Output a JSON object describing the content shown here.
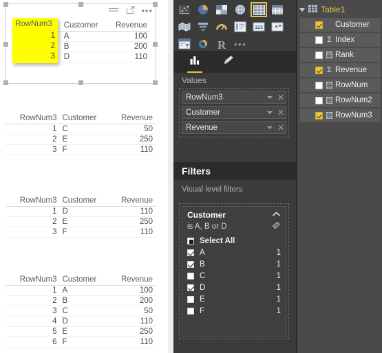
{
  "canvas": {
    "visuals": [
      {
        "id": "visual-filtered-top",
        "selected": true,
        "header": {
          "filter_icon": "filter-icon",
          "focus_icon": "focus-mode-icon",
          "more_icon": "more-options-ellipsis-icon"
        },
        "columns": [
          "RowNum3",
          "Customer",
          "Revenue"
        ],
        "rows": [
          [
            "1",
            "A",
            "100"
          ],
          [
            "2",
            "B",
            "200"
          ],
          [
            "3",
            "D",
            "110"
          ]
        ],
        "highlight": {
          "color": "#ffff00",
          "header": "RowNum3",
          "values": [
            "1",
            "2",
            "3"
          ]
        }
      },
      {
        "id": "visual-second",
        "selected": false,
        "columns": [
          "RowNum3",
          "Customer",
          "Revenue"
        ],
        "rows": [
          [
            "1",
            "C",
            "50"
          ],
          [
            "2",
            "E",
            "250"
          ],
          [
            "3",
            "F",
            "110"
          ]
        ]
      },
      {
        "id": "visual-third",
        "selected": false,
        "columns": [
          "RowNum3",
          "Customer",
          "Revenue"
        ],
        "rows": [
          [
            "1",
            "D",
            "110"
          ],
          [
            "2",
            "E",
            "250"
          ],
          [
            "3",
            "F",
            "110"
          ]
        ]
      },
      {
        "id": "visual-fourth",
        "selected": false,
        "columns": [
          "RowNum3",
          "Customer",
          "Revenue"
        ],
        "rows": [
          [
            "1",
            "A",
            "100"
          ],
          [
            "2",
            "B",
            "200"
          ],
          [
            "3",
            "C",
            "50"
          ],
          [
            "4",
            "D",
            "110"
          ],
          [
            "5",
            "E",
            "250"
          ],
          [
            "6",
            "F",
            "110"
          ]
        ]
      }
    ]
  },
  "visualizations": {
    "icon_rows": [
      [
        "scatter-chart-icon",
        "pie-chart-icon",
        "treemap-icon",
        "map-icon",
        "table-icon",
        "matrix-icon"
      ],
      [
        "filled-map-icon",
        "funnel-icon",
        "gauge-icon",
        "multi-row-card-icon",
        "card-icon",
        "kpi-icon"
      ],
      [
        "slicer-icon",
        "donut-chart-icon",
        "r-script-visual-icon",
        "more-visuals-ellipsis-icon"
      ]
    ],
    "selected_icon": "table-icon",
    "tabs": [
      {
        "name": "fields-tab",
        "icon": "bar-chart-icon",
        "active": true
      },
      {
        "name": "format-tab",
        "icon": "paintbrush-icon",
        "active": false
      }
    ],
    "values_header": "Values",
    "wells": [
      {
        "label": "RowNum3",
        "caret": "chevron-down-icon",
        "remove": "remove-field-icon"
      },
      {
        "label": "Customer",
        "caret": "chevron-down-icon",
        "remove": "remove-field-icon"
      },
      {
        "label": "Revenue",
        "caret": "chevron-down-icon",
        "remove": "remove-field-icon"
      }
    ],
    "filters_header": "Filters",
    "visual_level_filters_label": "Visual level filters",
    "filter_card": {
      "title": "Customer",
      "collapse_icon": "chevron-up-icon",
      "condition": "is A, B or D",
      "clear_icon": "eraser-clear-filter-icon",
      "items": [
        {
          "label": "Select All",
          "state": "indeterminate",
          "count": ""
        },
        {
          "label": "A",
          "state": "checked",
          "count": "1"
        },
        {
          "label": "B",
          "state": "checked",
          "count": "1"
        },
        {
          "label": "C",
          "state": "unchecked",
          "count": "1"
        },
        {
          "label": "D",
          "state": "checked",
          "count": "1"
        },
        {
          "label": "E",
          "state": "unchecked",
          "count": "1"
        },
        {
          "label": "F",
          "state": "unchecked",
          "count": "1"
        }
      ]
    }
  },
  "fields": {
    "table_name": "Table1",
    "table_icon": "table-grid-icon",
    "expand_icon": "triangle-expanded-icon",
    "items": [
      {
        "label": "Customer",
        "checked": true,
        "type_icon": "none"
      },
      {
        "label": "Index",
        "checked": false,
        "type_icon": "sigma"
      },
      {
        "label": "Rank",
        "checked": false,
        "type_icon": "calculated-column-icon"
      },
      {
        "label": "Revenue",
        "checked": true,
        "type_icon": "sigma"
      },
      {
        "label": "RowNum",
        "checked": false,
        "type_icon": "calculated-column-icon"
      },
      {
        "label": "RowNum2",
        "checked": false,
        "type_icon": "calculated-column-icon"
      },
      {
        "label": "RowNum3",
        "checked": true,
        "type_icon": "calculated-column-icon"
      }
    ]
  },
  "colors": {
    "accent_yellow": "#e8c547",
    "highlight_yellow": "#ffff00",
    "viz_pane_bg": "#3b3b3b",
    "fields_pane_bg": "#4a4a4a",
    "dark_header_bg": "#2b2b2b"
  }
}
